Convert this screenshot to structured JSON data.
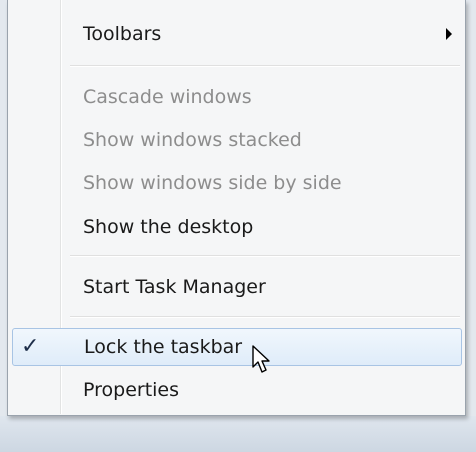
{
  "context_menu": {
    "items": [
      {
        "label": "Toolbars",
        "has_submenu": true,
        "enabled": true
      },
      {
        "label": "Cascade windows",
        "enabled": false
      },
      {
        "label": "Show windows stacked",
        "enabled": false
      },
      {
        "label": "Show windows side by side",
        "enabled": false
      },
      {
        "label": "Show the desktop",
        "enabled": true
      },
      {
        "label": "Start Task Manager",
        "enabled": true
      },
      {
        "label": "Lock the taskbar",
        "enabled": true,
        "checked": true,
        "highlighted": true
      },
      {
        "label": "Properties",
        "enabled": true
      }
    ],
    "check_glyph": "✓"
  },
  "icons": {
    "submenu": "chevron-right-icon",
    "check": "checkmark-icon",
    "cursor": "mouse-pointer-icon"
  },
  "colors": {
    "menu_background": "#f5f6f7",
    "disabled_text": "#8d8d8d",
    "highlight_border": "#a8c4e4",
    "highlight_fill": "#dfecf9"
  }
}
